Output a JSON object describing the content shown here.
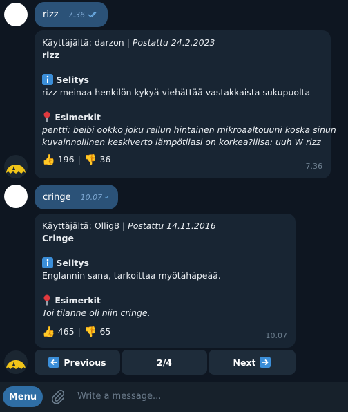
{
  "messages": [
    {
      "out_text": "rizz",
      "out_time": "7.36",
      "bot": {
        "author_line": "Käyttäjältä: darzon | ",
        "posted_line": "Postattu 24.2.2023",
        "title": "rizz",
        "explain_heading": "Selitys",
        "explain_text": "rizz meinaa henkilön kykyä viehättää vastakkaista sukupuolta",
        "examples_heading": "Esimerkit",
        "examples_line1": "pentti: beibi ookko joku reilun hintainen mikroaaltouuni koska sinun",
        "examples_line2": "kuvainnollinen keskiverto lämpötilasi on korkea?liisa: uuh W rizz",
        "likes": "196",
        "dislikes": "36",
        "separator": "|",
        "time": "7.36"
      }
    },
    {
      "out_text": "cringe",
      "out_time": "10.07",
      "bot": {
        "author_line": "Käyttäjältä: Ollig8 | ",
        "posted_line": "Postattu 14.11.2016",
        "title": "Cringe",
        "explain_heading": "Selitys",
        "explain_text": "Englannin sana, tarkoittaa myötähäpeää.",
        "examples_heading": "Esimerkit",
        "examples_line1": "Toi tilanne oli niin cringe.",
        "examples_line2": "",
        "likes": "465",
        "dislikes": "65",
        "separator": "|",
        "time": "10.07"
      }
    }
  ],
  "keyboard": {
    "previous": "Previous",
    "page": "2/4",
    "next": "Next"
  },
  "composer": {
    "menu_label": "Menu",
    "placeholder": "Write a message..."
  }
}
